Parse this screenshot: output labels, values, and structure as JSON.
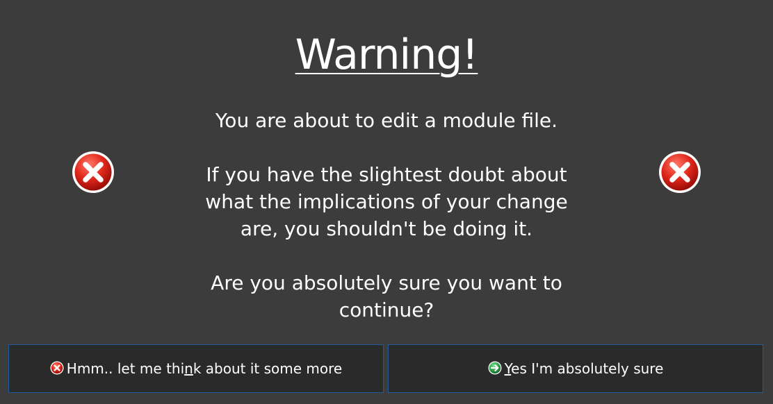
{
  "dialog": {
    "title": "Warning!",
    "message": {
      "line1": "You are about to edit a module file.",
      "para2_line1": "If you have the slightest doubt about",
      "para2_line2": "what the implications of your change",
      "para2_line3": "are, you shouldn't be doing it.",
      "para3_line1": "Are you absolutely sure you want to",
      "para3_line2": "continue?"
    },
    "icons": {
      "left": "error-icon",
      "right": "error-icon"
    }
  },
  "buttons": {
    "cancel": {
      "icon": "error-icon",
      "label_before": "Hmm.. let me thi",
      "label_mnemonic": "n",
      "label_after": "k about it some more"
    },
    "confirm": {
      "icon": "arrow-right-icon",
      "label_mnemonic": "Y",
      "label_after": "es I'm absolutely sure"
    }
  },
  "colors": {
    "background": "#3c3c3c",
    "button_background": "#2a2a2a",
    "button_border": "#1f5a9a",
    "error_red": "#d9251d",
    "confirm_green": "#2fa84f"
  }
}
